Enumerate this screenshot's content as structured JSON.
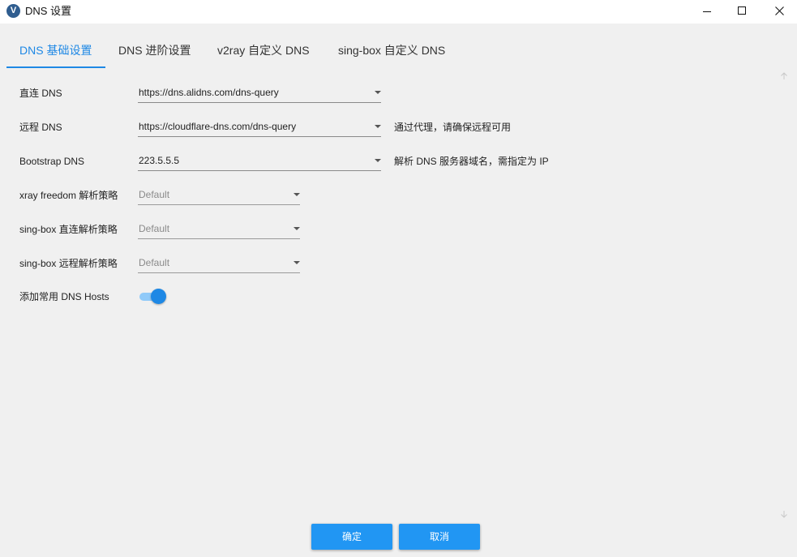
{
  "window": {
    "title": "DNS 设置",
    "app_icon_glyph": "V"
  },
  "tabs": [
    {
      "label": "DNS 基础设置",
      "active": true
    },
    {
      "label": "DNS 进阶设置",
      "active": false
    },
    {
      "label": "v2ray 自定义 DNS",
      "active": false
    },
    {
      "label": "sing-box 自定义 DNS",
      "active": false
    }
  ],
  "form": {
    "direct_dns": {
      "label": "直连 DNS",
      "value": "https://dns.alidns.com/dns-query"
    },
    "remote_dns": {
      "label": "远程 DNS",
      "value": "https://cloudflare-dns.com/dns-query",
      "hint": "通过代理，请确保远程可用"
    },
    "bootstrap_dns": {
      "label": "Bootstrap DNS",
      "value": "223.5.5.5",
      "hint": "解析 DNS 服务器域名，需指定为 IP"
    },
    "xray_freedom_strategy": {
      "label": "xray freedom 解析策略",
      "value": "Default"
    },
    "singbox_direct_strategy": {
      "label": "sing-box 直连解析策略",
      "value": "Default"
    },
    "singbox_remote_strategy": {
      "label": "sing-box 远程解析策略",
      "value": "Default"
    },
    "add_common_hosts": {
      "label": "添加常用 DNS Hosts",
      "enabled": true
    }
  },
  "buttons": {
    "ok": "确定",
    "cancel": "取消"
  },
  "colors": {
    "accent": "#1e88e5",
    "button": "#2196f3",
    "background": "#f0f0f0"
  }
}
